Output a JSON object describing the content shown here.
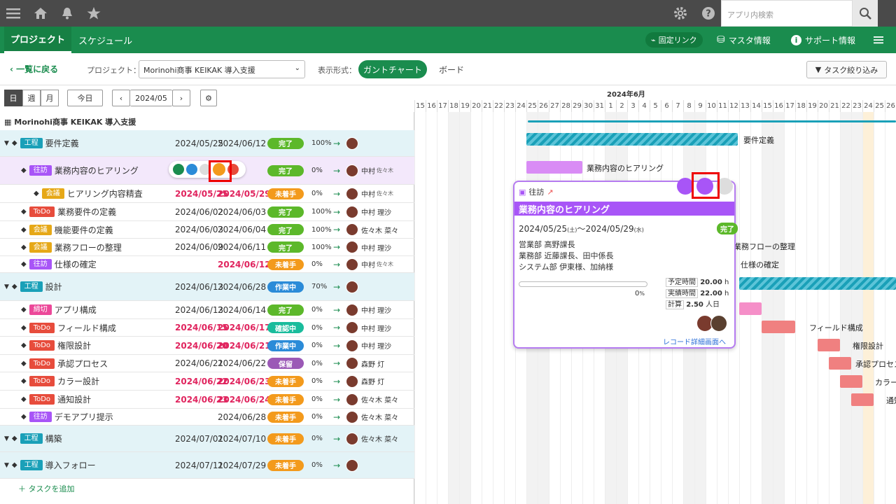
{
  "topbar": {
    "search_placeholder": "アプリ内検索"
  },
  "nav": {
    "tab_project": "プロジェクト",
    "tab_schedule": "スケジュール",
    "fixed_link": "固定リンク",
    "master": "マスタ情報",
    "support": "サポート情報"
  },
  "toolbar": {
    "back": "一覧に戻る",
    "project_label": "プロジェクト：",
    "project_value": "Morinohi商事 KEIKAK 導入支援",
    "display_label": "表示形式：",
    "gantt": "ガントチャート",
    "board": "ボード",
    "filter": "タスク絞り込み"
  },
  "ctrl": {
    "day": "日",
    "week": "週",
    "month": "月",
    "today": "今日",
    "month_value": "2024/05"
  },
  "project_title": "Morinohi商事 KEIKAK 導入支援",
  "rows": [
    {
      "kind": "工程",
      "title": "要件定義",
      "start": "2024/05/25",
      "end": "2024/06/12",
      "status": "完了",
      "pct": "100",
      "assignee": "",
      "group": true
    },
    {
      "kind": "往訪",
      "title": "業務内容のヒアリング",
      "start": "",
      "end": "29",
      "status": "完了",
      "pct": "0",
      "assignee": "中村",
      "assignee2": "佐々木"
    },
    {
      "kind": "会議",
      "title": "ヒアリング内容精査",
      "start": "2024/05/25",
      "end": "2024/05/29",
      "status": "未着手",
      "pct": "0",
      "assignee": "中村",
      "assignee2": "佐々木",
      "late": true
    },
    {
      "kind": "ToDo",
      "title": "業務要件の定義",
      "start": "2024/06/02",
      "end": "2024/06/03",
      "status": "完了",
      "pct": "100",
      "assignee": "中村 理沙"
    },
    {
      "kind": "会議",
      "title": "機能要件の定義",
      "start": "2024/06/03",
      "end": "2024/06/04",
      "status": "完了",
      "pct": "100",
      "assignee": "佐々木 菜々"
    },
    {
      "kind": "会議",
      "title": "業務フローの整理",
      "start": "2024/06/09",
      "end": "2024/06/11",
      "status": "完了",
      "pct": "100",
      "assignee": "中村 理沙"
    },
    {
      "kind": "往訪",
      "title": "仕様の確定",
      "start": "",
      "end": "2024/06/12",
      "status": "未着手",
      "pct": "0",
      "assignee": "中村",
      "assignee2": "佐々木",
      "late_end": true
    },
    {
      "kind": "工程",
      "title": "設計",
      "start": "2024/06/13",
      "end": "2024/06/28",
      "status": "作業中",
      "pct": "70",
      "assignee": "",
      "group": true
    },
    {
      "kind": "締切",
      "title": "アプリ構成",
      "start": "2024/06/13",
      "end": "2024/06/14",
      "status": "完了",
      "pct": "0",
      "assignee": "中村 理沙"
    },
    {
      "kind": "ToDo",
      "title": "フィールド構成",
      "start": "2024/06/15",
      "end": "2024/06/17",
      "status": "確認中",
      "pct": "0",
      "assignee": "中村 理沙",
      "late": true
    },
    {
      "kind": "ToDo",
      "title": "権限設計",
      "start": "2024/06/20",
      "end": "2024/06/21",
      "status": "作業中",
      "pct": "0",
      "assignee": "中村 理沙",
      "late": true
    },
    {
      "kind": "ToDo",
      "title": "承認プロセス",
      "start": "2024/06/21",
      "end": "2024/06/22",
      "status": "保留",
      "pct": "0",
      "assignee": "森野 灯"
    },
    {
      "kind": "ToDo",
      "title": "カラー設計",
      "start": "2024/06/22",
      "end": "2024/06/23",
      "status": "未着手",
      "pct": "0",
      "assignee": "森野 灯",
      "late": true
    },
    {
      "kind": "ToDo",
      "title": "通知設計",
      "start": "2024/06/23",
      "end": "2024/06/24",
      "status": "未着手",
      "pct": "0",
      "assignee": "佐々木 菜々",
      "late": true
    },
    {
      "kind": "往訪",
      "title": "デモアプリ提示",
      "start": "",
      "end": "2024/06/28",
      "status": "未着手",
      "pct": "0",
      "assignee": "佐々木 菜々"
    },
    {
      "kind": "工程",
      "title": "構築",
      "start": "2024/07/01",
      "end": "2024/07/10",
      "status": "未着手",
      "pct": "0",
      "assignee": "佐々木 菜々",
      "group": true
    },
    {
      "kind": "工程",
      "title": "導入フォロー",
      "start": "2024/07/11",
      "end": "2024/07/29",
      "status": "未着手",
      "pct": "0",
      "assignee": "",
      "group": true
    }
  ],
  "add_task": "タスクを追加",
  "gantt": {
    "month_label": "2024年6月",
    "days": [
      "15",
      "16",
      "17",
      "18",
      "19",
      "20",
      "21",
      "22",
      "23",
      "24",
      "25",
      "26",
      "27",
      "28",
      "29",
      "30",
      "31",
      "1",
      "2",
      "3",
      "4",
      "5",
      "6",
      "7",
      "8",
      "9",
      "10",
      "11",
      "12",
      "13",
      "14",
      "15",
      "16",
      "17",
      "18",
      "19",
      "20",
      "21",
      "22",
      "23",
      "24",
      "25",
      "26"
    ],
    "labels": {
      "req": "要件定義",
      "hearing": "業務内容のヒアリング",
      "flow": "業務フローの整理",
      "spec": "仕様の確定",
      "field": "フィールド構成",
      "perm": "権限設計",
      "approve": "承認プロセス",
      "color": "カラー",
      "notify": "通知"
    }
  },
  "popup": {
    "kind": "往訪",
    "title": "業務内容のヒアリング",
    "range_start": "2024/05/25",
    "range_start_dow": "(土)",
    "range_sep": "～",
    "range_end": "2024/05/29",
    "range_end_dow": "(水)",
    "status": "完了",
    "attendees": [
      "営業部 高野課長",
      "業務部 近藤課長、田中係長",
      "システム部 伊東様、加納様"
    ],
    "progress_pct": "0",
    "progress_unit": "%",
    "planned_label": "予定時間",
    "planned": "20.00",
    "planned_unit": "h",
    "actual_label": "実績時間",
    "actual": "22.00",
    "actual_unit": "h",
    "calc_label": "計算",
    "calc": "2.50",
    "calc_unit": "人日",
    "detail_link": "レコード詳細画面へ"
  },
  "colors": {
    "green": "#1a8c4e",
    "purple": "#a855f7",
    "pink": "#ec4899"
  }
}
